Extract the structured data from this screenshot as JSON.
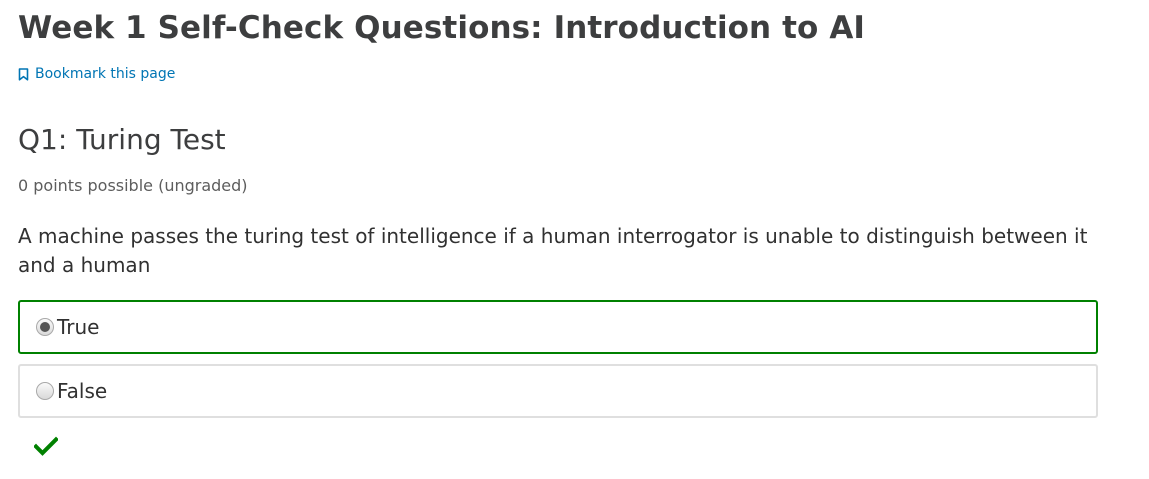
{
  "page_title": "Week 1 Self-Check Questions: Introduction to AI",
  "bookmark": {
    "label": "Bookmark this page",
    "icon": "bookmark-icon"
  },
  "question": {
    "title": "Q1: Turing Test",
    "points": "0 points possible (ungraded)",
    "prompt": "A machine passes the turing test of intelligence if a human interrogator is unable to distinguish between it and a human",
    "choices": [
      {
        "label": "True",
        "selected": true
      },
      {
        "label": "False",
        "selected": false
      }
    ],
    "status_icon": "checkmark-icon"
  },
  "colors": {
    "link": "#0075b4",
    "correct": "#008100",
    "border": "#dfdfdf",
    "title": "#3d3e3f"
  }
}
